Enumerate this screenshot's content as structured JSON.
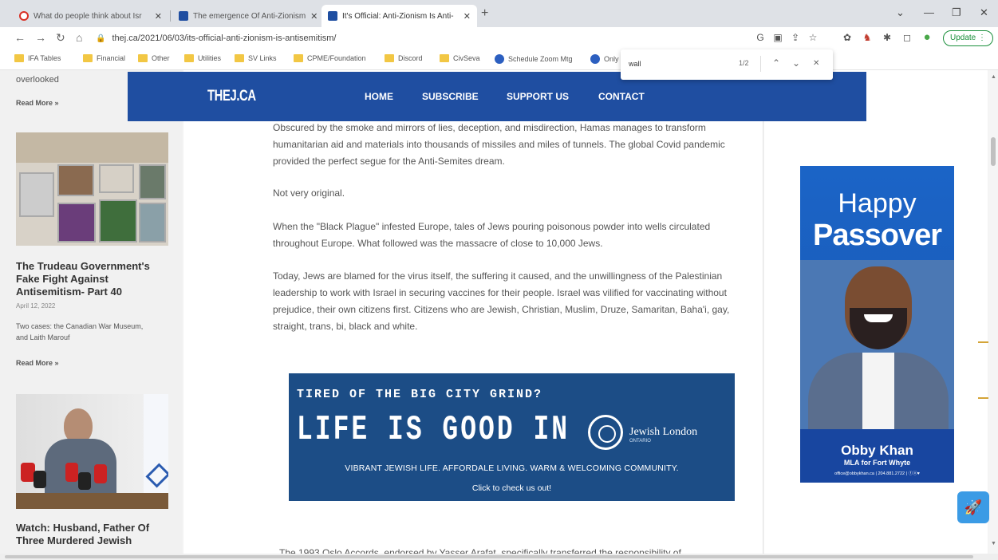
{
  "browser": {
    "tabs": [
      {
        "label": "What do people think about Isr",
        "favicon_color": "#d93025"
      },
      {
        "label": "The emergence Of Anti-Zionism",
        "favicon_color": "#1f4ea1"
      },
      {
        "label": "It's Official: Anti-Zionism Is Anti-",
        "favicon_color": "#1f4ea1"
      }
    ],
    "tab_close": "✕",
    "new_tab": "+",
    "window_controls": {
      "collapse": "⌄",
      "minimize": "—",
      "maximize": "❐",
      "close": "✕"
    },
    "nav": {
      "back": "←",
      "forward": "→",
      "reload": "↻",
      "home": "⌂"
    },
    "url": "thej.ca/2021/06/03/its-official-anti-zionism-is-antisemitism/",
    "lock": "🔒",
    "toolbar_icons": {
      "google": "G",
      "cast": "▣",
      "share": "⇪",
      "star": "☆",
      "ext1": "✿",
      "ext2": "♞",
      "puzzle": "✱",
      "sidepanel": "◻",
      "profile": "●"
    },
    "update_button": "Update ⋮",
    "bookmarks": [
      {
        "label": "IFA Tables",
        "icon": "folder"
      },
      {
        "label": "Financial",
        "icon": "folder"
      },
      {
        "label": "Other",
        "icon": "folder"
      },
      {
        "label": "Utilities",
        "icon": "folder"
      },
      {
        "label": "SV Links",
        "icon": "folder"
      },
      {
        "label": "CPME/Foundation",
        "icon": "folder"
      },
      {
        "label": "Discord",
        "icon": "folder"
      },
      {
        "label": "CivSeva",
        "icon": "folder"
      },
      {
        "label": "Schedule Zoom Mtg",
        "icon": "globe"
      },
      {
        "label": "Only",
        "icon": "globe"
      }
    ],
    "find": {
      "query": "wall",
      "count": "1/2",
      "prev": "⌃",
      "next": "⌄",
      "close": "✕"
    }
  },
  "site": {
    "logo": "THEJ.CA",
    "nav": [
      "HOME",
      "SUBSCRIBE",
      "SUPPORT US",
      "CONTACT"
    ]
  },
  "sidebar": {
    "overlooked": "overlooked",
    "read_more": "Read More »",
    "post1": {
      "title": "The Trudeau Government's Fake Fight Against Antisemitism- Part 40",
      "date": "April 12, 2022",
      "excerpt": "Two cases: the Canadian War Museum, and Laith Marouf"
    },
    "read_more2": "Read More »",
    "post2": {
      "title": "Watch: Husband, Father Of Three Murdered Jewish"
    }
  },
  "article": {
    "p1": "Obscured by the smoke and mirrors of lies, deception, and misdirection, Hamas manages to transform humanitarian aid and materials into thousands of missiles and miles of tunnels. The global Covid pandemic provided the perfect segue for the Anti-Semites dream.",
    "p2": "Not very original.",
    "p3": "When the \"Black Plague\" infested Europe, tales of Jews pouring poisonous powder into wells circulated throughout Europe. What followed was the massacre of close to 10,000 Jews.",
    "p4": "Today, Jews are blamed for the virus itself, the suffering it caused, and the unwillingness of the Palestinian leadership to work with Israel in securing vaccines for their people. Israel was vilified for vaccinating without prejudice, their own citizens first. Citizens who are Jewish, Christian, Muslim, Druze, Samaritan, Baha'i, gay, straight, trans, bi, black and white.",
    "p5": "The 1993 Oslo Accords, endorsed by Yasser Arafat, specifically transferred the responsibility of"
  },
  "banner_ad": {
    "tired": "TIRED OF THE BIG CITY GRIND?",
    "life": "LIFE IS GOOD IN",
    "org": "Jewish London",
    "org_sub": "ONTARIO",
    "tagline": "VIBRANT JEWISH LIFE. AFFORDALE LIVING. WARM & WELCOMING COMMUNITY.",
    "cta": "Click to check us out!"
  },
  "side_ad": {
    "happy": "Happy",
    "passover": "Passover",
    "name": "Obby Khan",
    "role": "MLA for Fort Whyte",
    "contact": "office@obbykhan.ca | 204.881.2722 | ⓕⓞ♥"
  },
  "floating": {
    "rocket": "🚀"
  },
  "colors": {
    "site_blue": "#1f4ea1",
    "ad_blue": "#1c4d86",
    "tab_bar": "#dee1e6",
    "update_green": "#1a8f3b"
  }
}
